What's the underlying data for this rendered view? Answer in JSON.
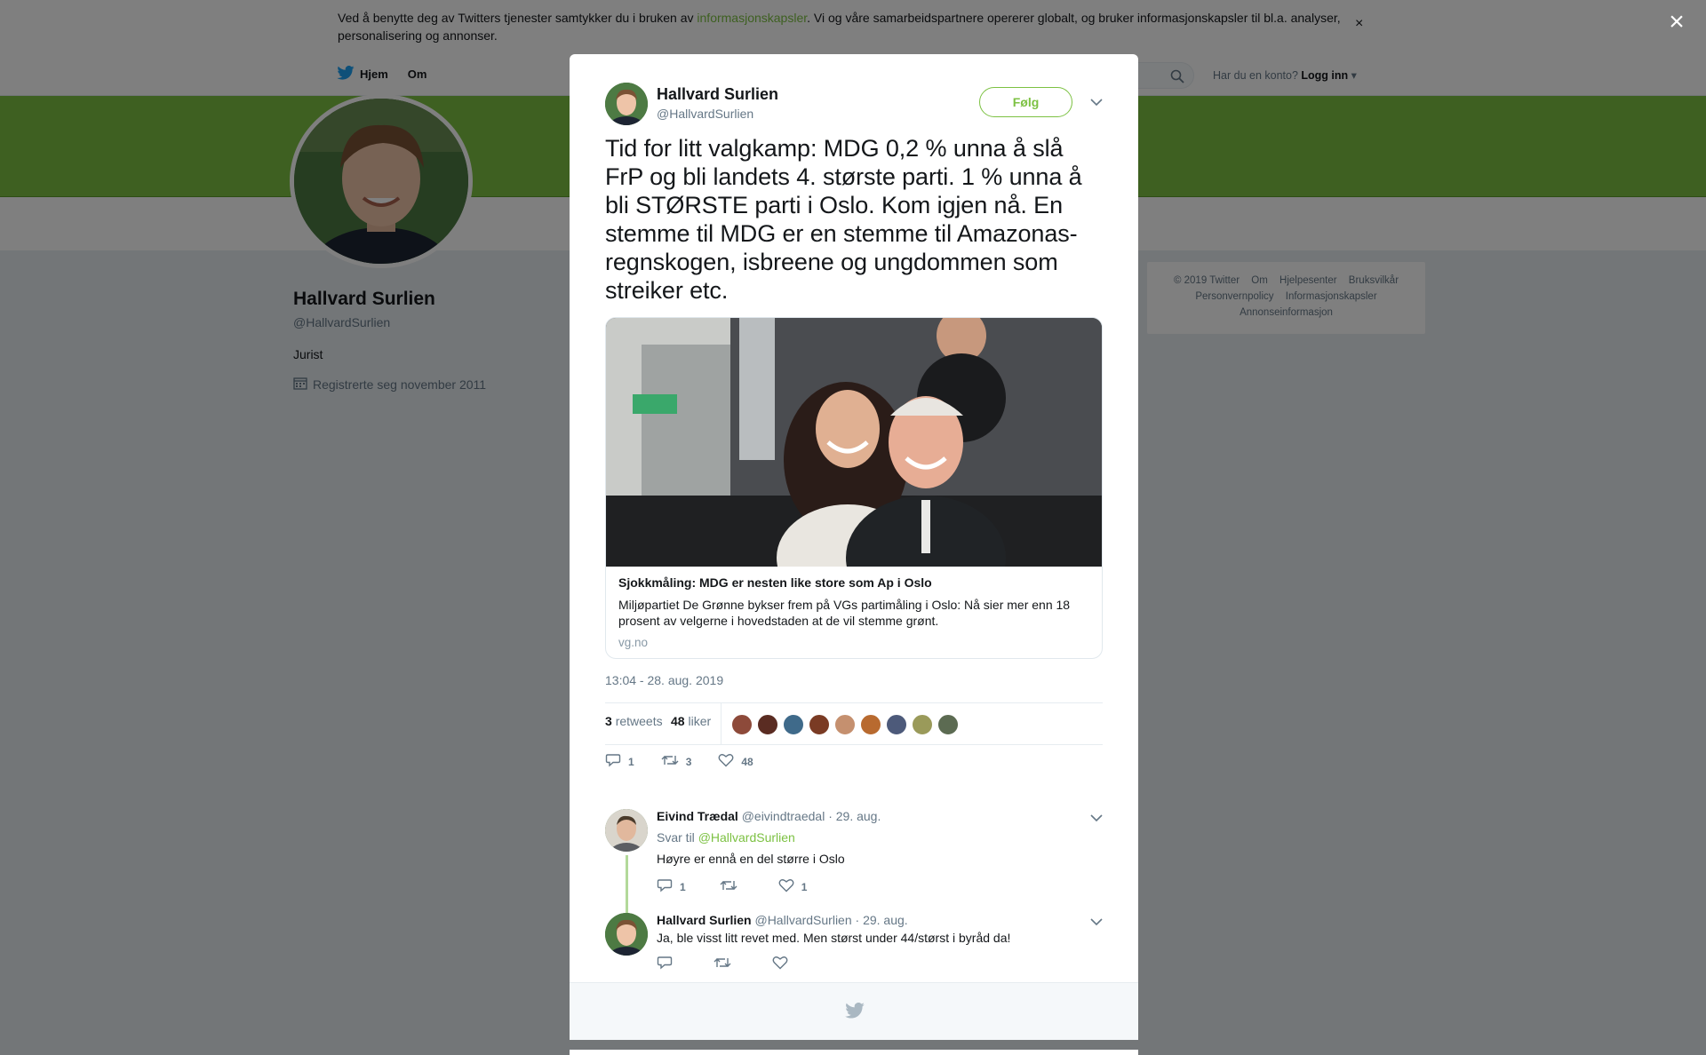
{
  "cookie_banner": {
    "text_before": "Ved å benytte deg av Twitters tjenester samtykker du i bruken av ",
    "link": "informasjonskapsler",
    "text_after": ". Vi og våre samarbeidspartnere opererer globalt, og bruker informasjonskapsler til bl.a. analyser, personalisering og annonser.",
    "close": "×"
  },
  "nav": {
    "home": "Hjem",
    "about": "Om",
    "login_prompt": "Har du en konto?",
    "login": "Logg inn"
  },
  "profile": {
    "name": "Hallvard Surlien",
    "handle": "@HallvardSurlien",
    "bio": "Jurist",
    "joined": "Registrerte seg november 2011"
  },
  "footer": [
    "© 2019 Twitter",
    "Om",
    "Hjelpesenter",
    "Bruksvilkår",
    "Personvernpolicy",
    "Informasjonskapsler",
    "Annonseinformasjon"
  ],
  "overlay_close": "×",
  "tweet": {
    "author_name": "Hallvard Surlien",
    "author_handle": "@HallvardSurlien",
    "follow_label": "Følg",
    "text": "Tid for litt valgkamp: MDG 0,2 % unna å slå FrP og bli landets 4. største parti. 1 % unna å bli STØRSTE parti i Oslo. Kom igjen nå. En stemme til MDG er en stemme til Amazonas-regnskogen, isbreene og ungdommen som streiker etc.",
    "card": {
      "title": "Sjokkmåling: MDG er nesten like store som Ap i Oslo",
      "description": "Miljøpartiet De Grønne bykser frem på VGs partimåling i Oslo: Nå sier mer enn 18 prosent av velgerne i hovedstaden at de vil stemme grønt.",
      "domain": "vg.no"
    },
    "timestamp": "13:04 - 28. aug. 2019",
    "retweets_count": "3",
    "retweets_label": "retweets",
    "likes_count": "48",
    "likes_label": "liker",
    "actions": {
      "reply": "1",
      "retweet": "3",
      "like": "48"
    }
  },
  "replies": [
    {
      "name": "Eivind Trædal",
      "handle": "@eivindtraedal",
      "date": "· 29. aug.",
      "reply_to_prefix": "Svar til ",
      "reply_to": "@HallvardSurlien",
      "text": "Høyre er ennå en del større i Oslo",
      "reply_count": "1",
      "retweet_count": "",
      "like_count": "1"
    },
    {
      "name": "Hallvard Surlien",
      "handle": "@HallvardSurlien",
      "date": "· 29. aug.",
      "text": "Ja, ble visst litt revet med. Men størst under 44/størst i byråd da!",
      "reply_count": "",
      "retweet_count": "",
      "like_count": ""
    }
  ],
  "colors": {
    "accent": "#7cc142",
    "overlay": "rgba(0,0,0,0.5)",
    "muted": "#657786"
  }
}
